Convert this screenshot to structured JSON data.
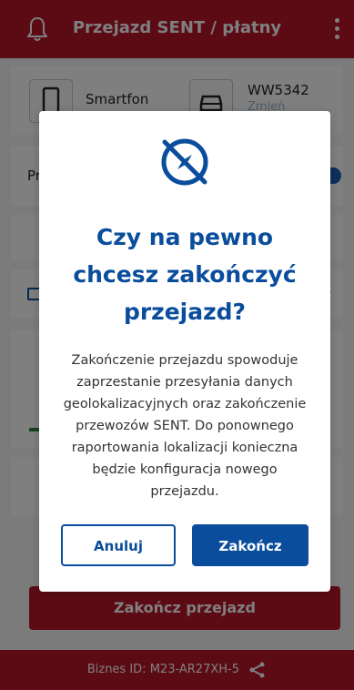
{
  "header": {
    "title": "Przejazd SENT / płatny"
  },
  "device": {
    "label": "Smartfon"
  },
  "vehicle": {
    "plate": "WW5342",
    "change_label": "Zmień"
  },
  "row_prefix": "Pr",
  "primary_action": {
    "label": "Zakończ przejazd"
  },
  "footer": {
    "label": "Biznes ID:",
    "id": "M23-AR27XH-5"
  },
  "dialog": {
    "title": "Czy na pewno chcesz zakończyć przejazd?",
    "title_lines": [
      "Czy na pewno",
      "chcesz zakończyć",
      "przejazd?"
    ],
    "message": "Zakończenie przejazdu spowoduje zaprzestanie przesyłania danych geolokalizacyjnych oraz zakończenie przewozów SENT. Do ponownego raportowania lokalizacji konieczna będzie konfiguracja nowego przejazdu.",
    "cancel_label": "Anuluj",
    "confirm_label": "Zakończ"
  },
  "colors": {
    "brand_red": "#b8172b",
    "primary_blue": "#0a4d9c"
  },
  "icons": {
    "header_left": "bell-icon",
    "header_right": "more-vertical-icon",
    "device": "smartphone-icon",
    "vehicle": "car-icon",
    "dialog": "compass-off-icon",
    "footer": "share-icon"
  }
}
